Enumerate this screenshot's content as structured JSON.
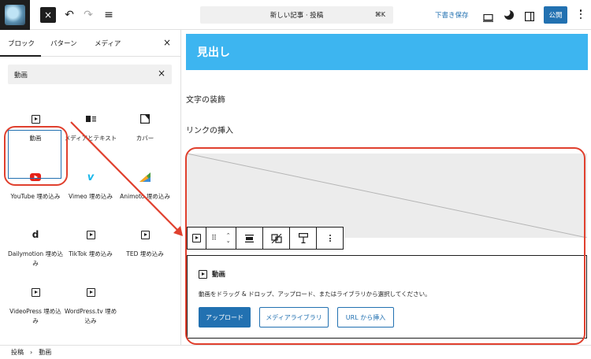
{
  "topbar": {
    "close_icon": "×",
    "undo_icon": "↶",
    "redo_icon": "↷",
    "list_icon": "≡",
    "command_title": "新しい記事 · 投稿",
    "command_shortcut": "⌘K",
    "draft_label": "下書き保存",
    "publish_label": "公開"
  },
  "inserter": {
    "tabs": [
      "ブロック",
      "パターン",
      "メディア"
    ],
    "close_icon": "×",
    "search_value": "動画",
    "clear_icon": "×",
    "blocks": [
      {
        "label": "動画",
        "icon": "video-icon"
      },
      {
        "label": "メディアとテキスト",
        "icon": "media-text-icon"
      },
      {
        "label": "カバー",
        "icon": "cover-icon"
      },
      {
        "label": "YouTube 埋め込み",
        "icon": "youtube-icon"
      },
      {
        "label": "Vimeo 埋め込み",
        "icon": "vimeo-icon"
      },
      {
        "label": "Animoto 埋め込み",
        "icon": "animoto-icon"
      },
      {
        "label": "Dailymotion 埋め込み",
        "icon": "dailymotion-icon"
      },
      {
        "label": "TikTok 埋め込み",
        "icon": "video-icon"
      },
      {
        "label": "TED 埋め込み",
        "icon": "video-icon"
      },
      {
        "label": "VideoPress 埋め込み",
        "icon": "video-icon"
      },
      {
        "label": "WordPress.tv 埋め込み",
        "icon": "video-icon"
      }
    ]
  },
  "editor": {
    "heading": "見出し",
    "para1": "文字の装飾",
    "para2": "リンクの挿入",
    "video_block": {
      "title": "動画",
      "description": "動画をドラッグ & ドロップ、アップロード、またはライブラリから選択してください。",
      "upload_label": "アップロード",
      "library_label": "メディアライブラリ",
      "url_label": "URL から挿入"
    }
  },
  "breadcrumb": {
    "items": [
      "投稿",
      "動画"
    ],
    "separator": "›"
  },
  "colors": {
    "accent": "#2271b1",
    "heading_bg": "#3db5f0",
    "annotation_red": "#e0402e"
  }
}
